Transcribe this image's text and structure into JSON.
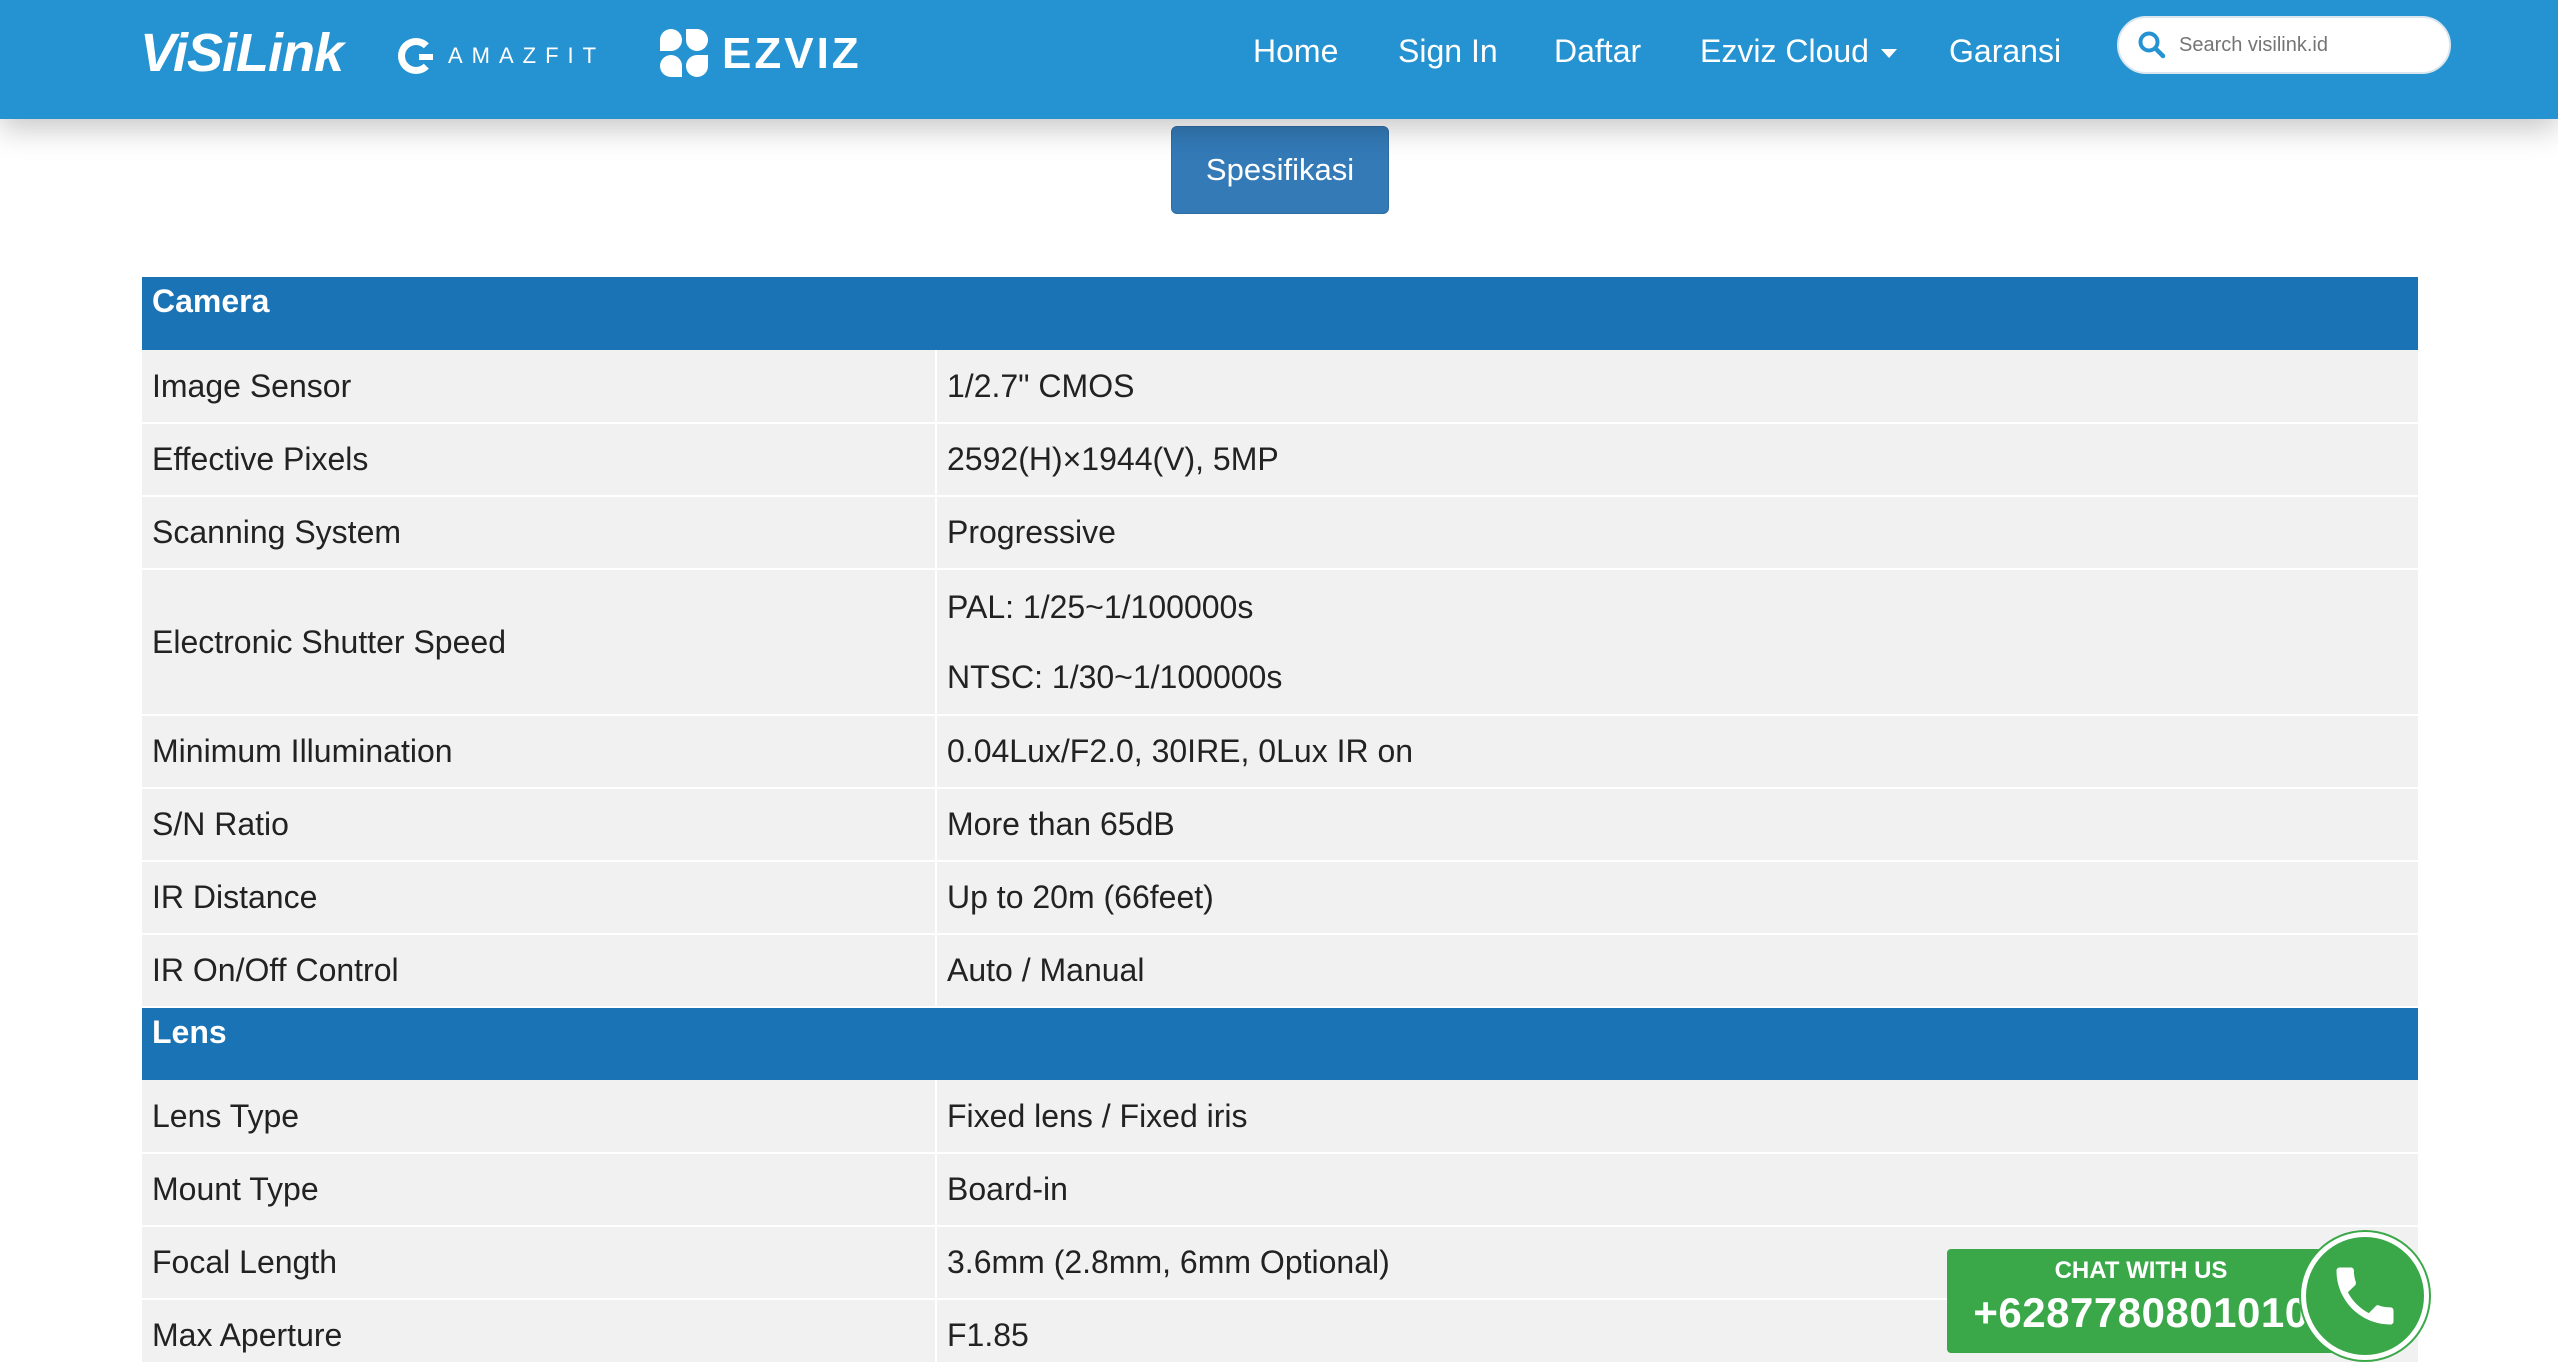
{
  "header": {
    "brand": "ViSiLink",
    "partner_1": "AMAZFIT",
    "partner_2": "EZVIZ",
    "nav": [
      {
        "label": "Home"
      },
      {
        "label": "Sign In"
      },
      {
        "label": "Daftar"
      },
      {
        "label": "Ezviz Cloud"
      },
      {
        "label": "Garansi"
      }
    ],
    "search_placeholder": "Search visilink.id"
  },
  "spec_button": "Spesifikasi",
  "sections": [
    {
      "title": "Camera",
      "rows": [
        {
          "key": "Image Sensor",
          "value": "1/2.7\" CMOS"
        },
        {
          "key": "Effective Pixels",
          "value": "2592(H)×1944(V), 5MP"
        },
        {
          "key": "Scanning System",
          "value": "Progressive"
        },
        {
          "key": "Electronic Shutter Speed",
          "values": [
            "PAL: 1/25~1/100000s",
            "NTSC: 1/30~1/100000s"
          ]
        },
        {
          "key": "Minimum Illumination",
          "value": "0.04Lux/F2.0, 30IRE, 0Lux IR on"
        },
        {
          "key": "S/N Ratio",
          "value": "More than 65dB"
        },
        {
          "key": "IR Distance",
          "value": "Up to 20m (66feet)"
        },
        {
          "key": "IR On/Off Control",
          "value": "Auto / Manual"
        }
      ]
    },
    {
      "title": "Lens",
      "rows": [
        {
          "key": "Lens Type",
          "value": "Fixed lens / Fixed iris"
        },
        {
          "key": "Mount Type",
          "value": "Board-in"
        },
        {
          "key": "Focal Length",
          "value": "3.6mm (2.8mm, 6mm Optional)"
        },
        {
          "key": "Max Aperture",
          "value": "F1.85"
        }
      ]
    }
  ],
  "chat": {
    "label": "CHAT WITH US",
    "number": "+6287780801010"
  },
  "colors": {
    "navbar": "#2593d1",
    "section_header": "#1a73b5",
    "row_bg": "#f1f1f1",
    "button": "#337ab7",
    "chat": "#3aa849"
  }
}
